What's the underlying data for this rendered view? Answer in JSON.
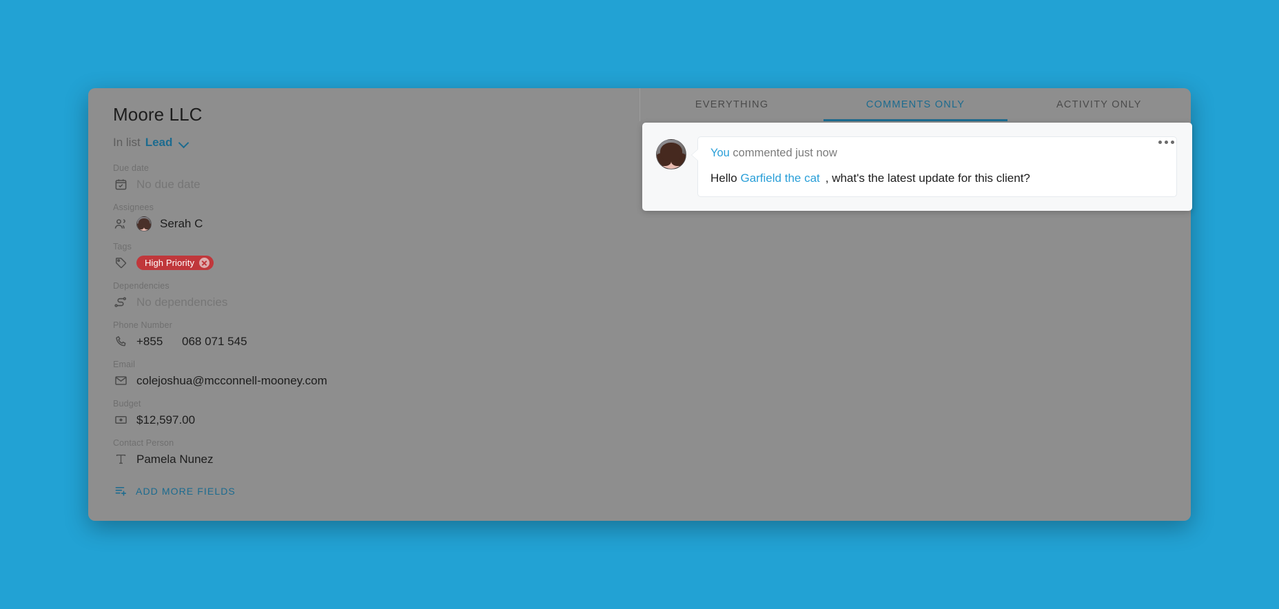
{
  "card": {
    "title": "Moore LLC",
    "in_list_prefix": "In list",
    "in_list_value": "Lead",
    "fields": [
      {
        "label": "Due date",
        "icon": "calendar-check-icon",
        "value": "No due date",
        "muted": true
      },
      {
        "label": "Assignees",
        "icon": "people-icon",
        "value": "Serah C",
        "muted": false
      },
      {
        "label": "Tags",
        "icon": "tag-icon",
        "value": "High Priority",
        "muted": false
      },
      {
        "label": "Dependencies",
        "icon": "dependency-icon",
        "value": "No dependencies",
        "muted": true
      },
      {
        "label": "Phone Number",
        "icon": "phone-icon",
        "value": "068 071 545",
        "muted": false,
        "country_code": "+855"
      },
      {
        "label": "Email",
        "icon": "envelope-icon",
        "value": "colejoshua@mcconnell-mooney.com",
        "muted": false
      },
      {
        "label": "Budget",
        "icon": "money-icon",
        "value": "$12,597.00",
        "muted": false
      },
      {
        "label": "Contact Person",
        "icon": "text-icon",
        "value": "Pamela Nunez",
        "muted": false
      }
    ],
    "add_more_fields_label": "ADD MORE FIELDS",
    "add_more_fields_icon": "list-plus-icon"
  },
  "activity": {
    "tabs": [
      {
        "label": "EVERYTHING",
        "active": false
      },
      {
        "label": "COMMENTS ONLY",
        "active": true
      },
      {
        "label": "ACTIVITY ONLY",
        "active": false
      }
    ],
    "comment": {
      "author": "You",
      "meta": " commented just now",
      "body_prefix": "Hello ",
      "mention": "Garfield the cat",
      "body_suffix": ", what's the latest update for this client?",
      "menu_icon": "more-horizontal-icon",
      "avatar": "user-avatar"
    }
  },
  "colors": {
    "page_background": "#22a2d4",
    "panel": "#8e8e8e",
    "accent": "#1c6b8f",
    "link": "#2a9fd8",
    "tag": "#c0373b"
  }
}
